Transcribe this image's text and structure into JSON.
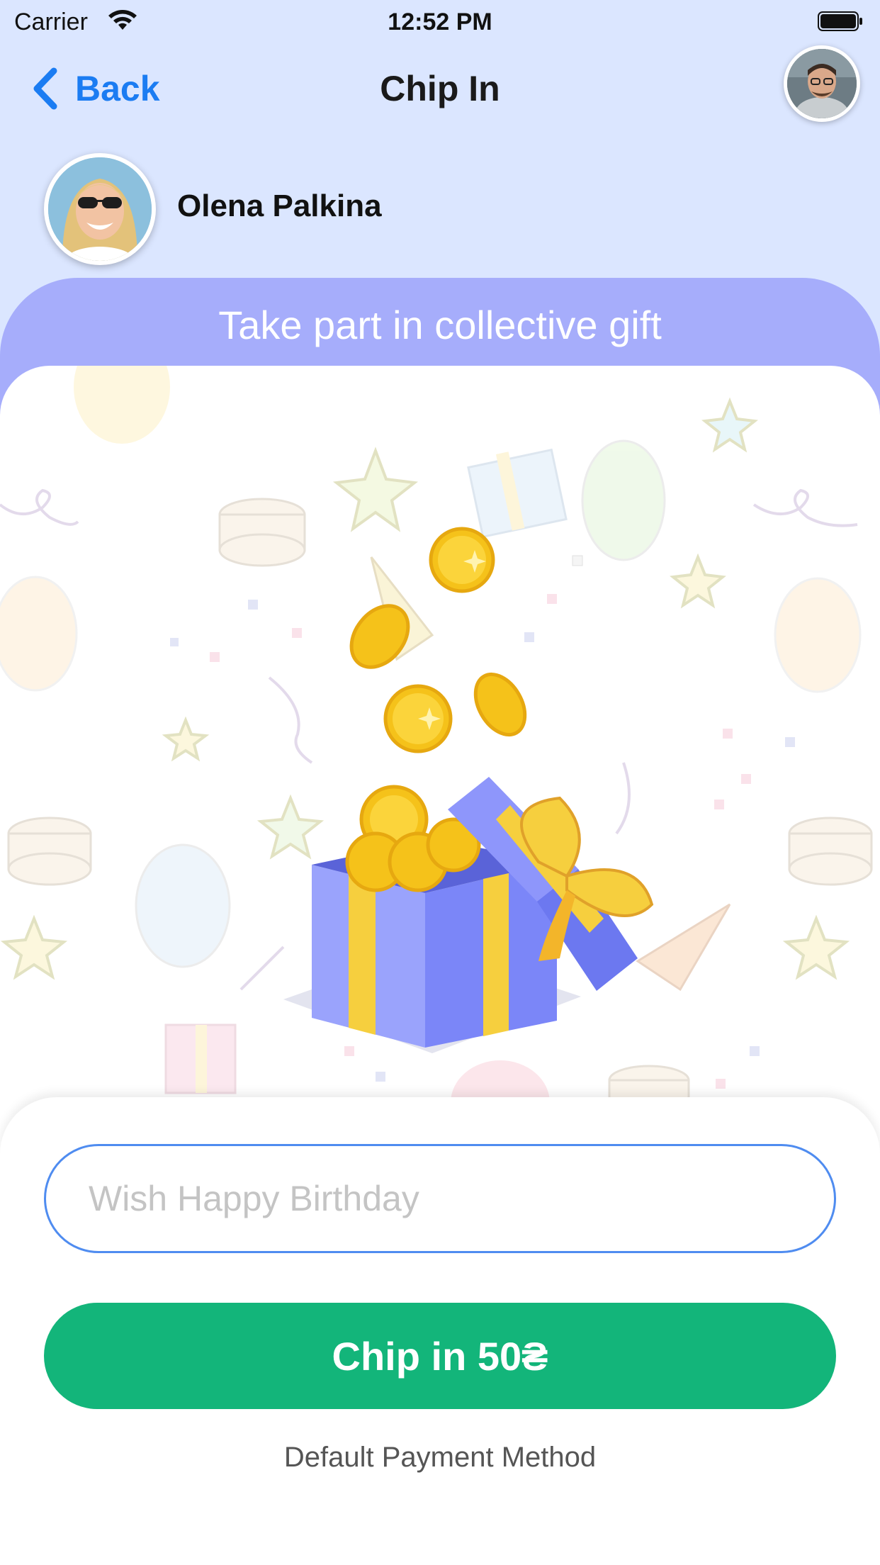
{
  "status_bar": {
    "carrier": "Carrier",
    "time": "12:52 PM"
  },
  "nav": {
    "back_label": "Back",
    "title": "Chip In"
  },
  "profile": {
    "name": "Olena Palkina"
  },
  "gift_section": {
    "title": "Take part in collective gift"
  },
  "wish_input": {
    "placeholder": "Wish Happy Birthday",
    "value": ""
  },
  "chip_button": {
    "label": "Chip in 50₴"
  },
  "payment": {
    "label": "Default Payment Method"
  },
  "colors": {
    "accent": "#1b7cf2",
    "primary_button": "#13b57a",
    "header_purple": "#a6adfb",
    "top_background": "#dbe6ff",
    "gift_box": "#8e96fb",
    "ribbon": "#f6cf3e"
  },
  "icons": [
    "wifi-icon",
    "battery-icon",
    "chevron-left-icon",
    "gift-box-illustration",
    "coin-icon"
  ]
}
